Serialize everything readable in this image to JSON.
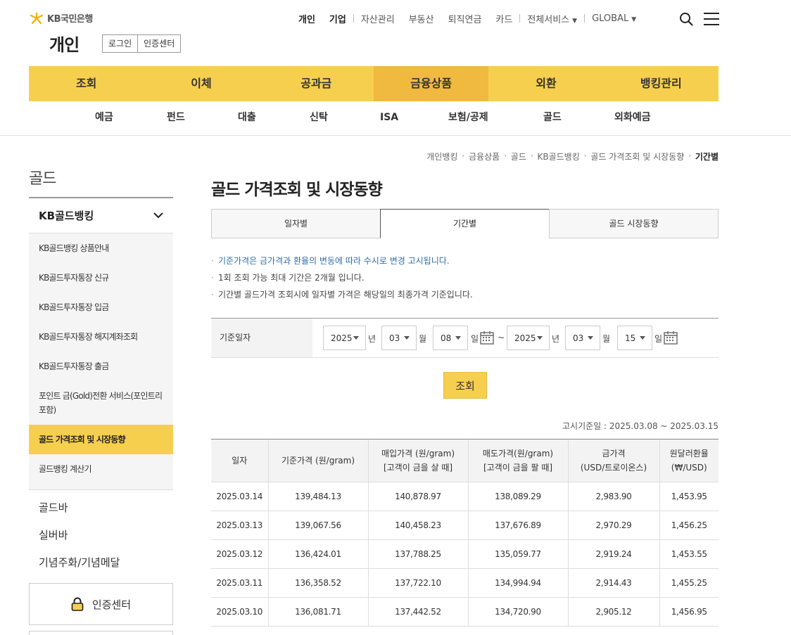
{
  "header": {
    "brand": "KB국민은행",
    "page_kind": "개인",
    "auth_links": [
      "로그인",
      "인증센터"
    ],
    "util_nav": [
      {
        "label": "개인",
        "strong": true
      },
      {
        "label": "기업",
        "strong": true
      },
      {
        "label": "자산관리"
      },
      {
        "label": "부동산"
      },
      {
        "label": "퇴직연금"
      },
      {
        "label": "카드"
      },
      {
        "label": "전체서비스"
      },
      {
        "label": "GLOBAL"
      }
    ],
    "icons": [
      "search-icon",
      "menu-icon"
    ]
  },
  "gnb": {
    "items": [
      "조회",
      "이체",
      "공과금",
      "금융상품",
      "외환",
      "뱅킹관리"
    ],
    "active": "금융상품"
  },
  "sub_gnb": [
    "예금",
    "펀드",
    "대출",
    "신탁",
    "ISA",
    "보험/공제",
    "골드",
    "외화예금"
  ],
  "breadcrumb": [
    "개인뱅킹",
    "금융상품",
    "골드",
    "KB골드뱅킹",
    "골드 가격조회 및 시장동향",
    "기간별"
  ],
  "sidebar": {
    "title": "골드",
    "group": "KB골드뱅킹",
    "items": [
      "KB골드뱅킹 상품안내",
      "KB골드투자통장 신규",
      "KB골드투자통장 입금",
      "KB골드투자통장 해지계좌조회",
      "KB골드투자통장 출금",
      "포인트 금(Gold)전환 서비스(포인트리 포함)",
      "골드 가격조회 및 시장동향",
      "골드뱅킹 계산기"
    ],
    "active_item": "골드 가격조회 및 시장동향",
    "more": [
      "골드바",
      "실버바",
      "기념주화/기념메달"
    ],
    "cert_center": "인증센터"
  },
  "main": {
    "title": "골드 가격조회 및 시장동향",
    "tabs": [
      "일자별",
      "기간별",
      "골드 시장동향"
    ],
    "active_tab": "기간별",
    "notes": [
      "기준가격은 금가격과 환율의 변동에 따라 수시로 변경 고시됩니다.",
      "1회 조회 가능 최대 기간은 2개월 입니다.",
      "기간별 골드가격 조회시에 일자별 가격은 해당일의 최종가격 기준입니다."
    ],
    "condition": {
      "label": "기준일자",
      "from": {
        "year": "2025",
        "month": "03",
        "day": "08"
      },
      "to": {
        "year": "2025",
        "month": "03",
        "day": "15"
      },
      "unit_year": "년",
      "unit_month": "월",
      "unit_day": "일",
      "tilde": "~"
    },
    "search_button": "조회",
    "notice_date": "고시기준일 : 2025.03.08 ~ 2025.03.15",
    "table": {
      "headers": [
        [
          "일자"
        ],
        [
          "기준가격 (원/gram)"
        ],
        [
          "매입가격 (원/gram)",
          "[고객이 금을 살 때]"
        ],
        [
          "매도가격(원/gram)",
          "[고객이 금을 팔 때]"
        ],
        [
          "금가격",
          "(USD/트로이온스)"
        ],
        [
          "원달러환율",
          "(₩/USD)"
        ]
      ],
      "rows": [
        [
          "2025.03.14",
          "139,484.13",
          "140,878.97",
          "138,089.29",
          "2,983.90",
          "1,453.95"
        ],
        [
          "2025.03.13",
          "139,067.56",
          "140,458.23",
          "137,676.89",
          "2,970.29",
          "1,456.25"
        ],
        [
          "2025.03.12",
          "136,424.01",
          "137,788.25",
          "135,059.77",
          "2,919.24",
          "1,453.55"
        ],
        [
          "2025.03.11",
          "136,358.52",
          "137,722.10",
          "134,994.94",
          "2,914.43",
          "1,455.25"
        ],
        [
          "2025.03.10",
          "136,081.71",
          "137,442.52",
          "134,720.90",
          "2,905.12",
          "1,456.95"
        ]
      ]
    }
  },
  "colors": {
    "accent": "#f7cf4f",
    "accent_active": "#f0b93f",
    "note_highlight": "#2f6fa7"
  }
}
